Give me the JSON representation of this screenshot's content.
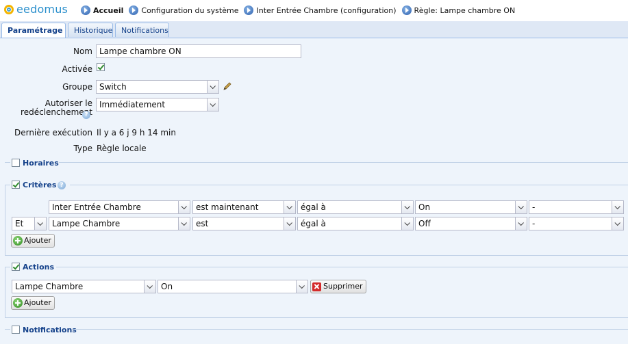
{
  "header": {
    "logo_text": "eedomus",
    "breadcrumbs": [
      "Accueil",
      "Configuration du système",
      "Inter Entrée Chambre (configuration)",
      "Règle: Lampe chambre ON"
    ]
  },
  "tabs": [
    {
      "label": "Paramétrage",
      "active": true
    },
    {
      "label": "Historique",
      "active": false
    },
    {
      "label": "Notifications",
      "active": false
    }
  ],
  "form": {
    "nom_label": "Nom",
    "nom_value": "Lampe chambre ON",
    "activee_label": "Activée",
    "activee_checked": true,
    "groupe_label": "Groupe",
    "groupe_value": "Switch",
    "autoriser_label_1": "Autoriser le",
    "autoriser_label_2": "redéclenchement",
    "autoriser_value": "Immédiatement",
    "derniere_label": "Dernière exécution",
    "derniere_value": "Il y a 6 j 9 h 14 min",
    "type_label": "Type",
    "type_value": "Règle locale"
  },
  "sections": {
    "horaires": {
      "title": "Horaires",
      "checked": false
    },
    "criteres": {
      "title": "Critères",
      "checked": true
    },
    "actions": {
      "title": "Actions",
      "checked": true
    },
    "notifications": {
      "title": "Notifications",
      "checked": false
    }
  },
  "criteria_rows": [
    {
      "conj": "",
      "device": "Inter Entrée Chambre",
      "verb": "est maintenant",
      "op": "égal à",
      "value": "On",
      "extra": "-"
    },
    {
      "conj": "Et",
      "device": "Lampe Chambre",
      "verb": "est",
      "op": "égal à",
      "value": "Off",
      "extra": "-"
    }
  ],
  "action_row": {
    "device": "Lampe Chambre",
    "value": "On",
    "remove_label": "Supprimer"
  },
  "buttons": {
    "ajouter": "Ajouter"
  },
  "colors": {
    "accent": "#15428b",
    "logo_blue": "#2a8fcc",
    "logo_yellow": "#f3b400",
    "check_green": "#2d8a2d"
  }
}
